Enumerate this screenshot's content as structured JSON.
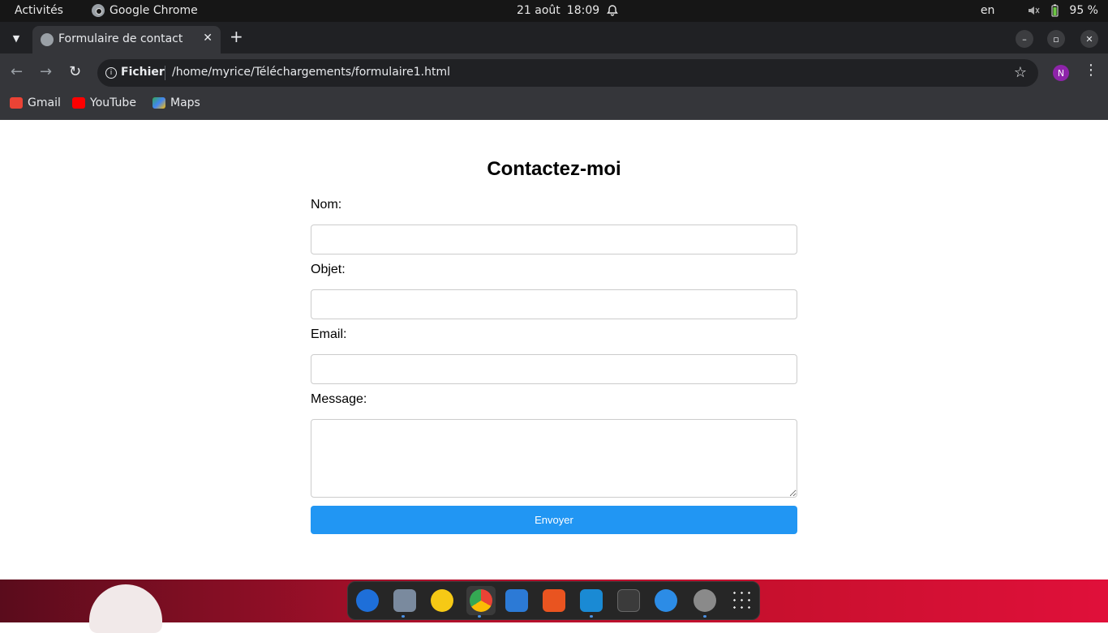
{
  "system_bar": {
    "activities": "Activités",
    "app_name": "Google Chrome",
    "date": "21 août",
    "time": "18:09",
    "language": "en",
    "battery": "95 %"
  },
  "browser": {
    "tab_title": "Formulaire de contact",
    "address_scheme": "Fichier",
    "address_url": "/home/myrice/Téléchargements/formulaire1.html",
    "profile_initial": "N",
    "bookmarks": [
      {
        "label": "Gmail",
        "icon": "gmail-icon",
        "color": "#ea4335"
      },
      {
        "label": "YouTube",
        "icon": "youtube-icon",
        "color": "#ff0000"
      },
      {
        "label": "Maps",
        "icon": "maps-icon",
        "color": "#34a853"
      }
    ]
  },
  "form": {
    "title": "Contactez-moi",
    "name_label": "Nom:",
    "name_value": "",
    "subject_label": "Objet:",
    "subject_value": "",
    "email_label": "Email:",
    "email_value": "",
    "message_label": "Message:",
    "message_value": "",
    "submit_label": "Envoyer",
    "submit_color": "#2196f3"
  },
  "dock": {
    "apps": [
      "thunderbird-icon",
      "files-icon",
      "rhythmbox-icon",
      "chrome-icon",
      "writer-icon",
      "app-center-icon",
      "vscode-icon",
      "terminal-icon",
      "help-icon",
      "settings-icon",
      "app-grid-icon"
    ]
  }
}
